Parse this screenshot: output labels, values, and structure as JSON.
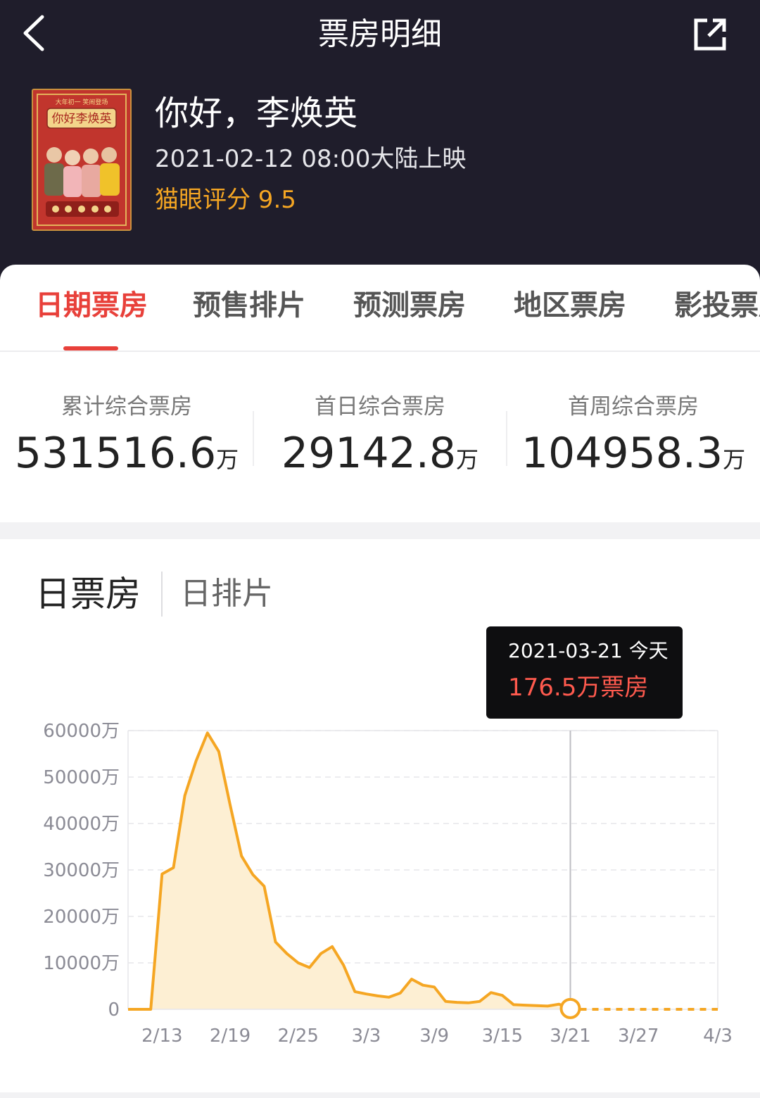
{
  "header": {
    "title": "票房明细",
    "back_icon": "back-arrow-icon",
    "share_icon": "share-icon"
  },
  "movie": {
    "title": "你好，李焕英",
    "release": "2021-02-12 08:00大陆上映",
    "rating": "猫眼评分 9.5",
    "poster_title": "你好李焕英",
    "poster_tagline": "大年初一 笑闹登场"
  },
  "tabs": [
    {
      "label": "日期票房",
      "active": true
    },
    {
      "label": "预售排片",
      "active": false
    },
    {
      "label": "预测票房",
      "active": false
    },
    {
      "label": "地区票房",
      "active": false
    },
    {
      "label": "影投票房",
      "active": false
    }
  ],
  "stats": [
    {
      "label": "累计综合票房",
      "value": "531516.6",
      "unit": "万"
    },
    {
      "label": "首日综合票房",
      "value": "29142.8",
      "unit": "万"
    },
    {
      "label": "首周综合票房",
      "value": "104958.3",
      "unit": "万"
    }
  ],
  "chart_tabs": {
    "active": "日票房",
    "other": "日排片"
  },
  "tooltip": {
    "date": "2021-03-21 今天",
    "value": "176.5万票房"
  },
  "colors": {
    "accent": "#e8403a",
    "line": "#f5a623",
    "area": "#fdefd3",
    "header_bg": "#1f1d2b"
  },
  "chart_data": {
    "type": "area",
    "ylabel_unit": "万",
    "ylim": [
      0,
      60000
    ],
    "yticks": [
      "60000万",
      "50000万",
      "40000万",
      "30000万",
      "20000万",
      "10000万",
      "0"
    ],
    "xticks": [
      "2/13",
      "2/19",
      "2/25",
      "3/3",
      "3/9",
      "3/15",
      "3/21",
      "3/27",
      "4/3"
    ],
    "series": [
      {
        "x": [
          "2/10",
          "2/11",
          "2/12",
          "2/13",
          "2/14",
          "2/15",
          "2/16",
          "2/17",
          "2/18",
          "2/19",
          "2/20",
          "2/21",
          "2/22",
          "2/23",
          "2/24",
          "2/25",
          "2/26",
          "2/27",
          "2/28",
          "3/1",
          "3/2",
          "3/3",
          "3/4",
          "3/5",
          "3/6",
          "3/7",
          "3/8",
          "3/9",
          "3/10",
          "3/11",
          "3/12",
          "3/13",
          "3/14",
          "3/15",
          "3/16",
          "3/17",
          "3/18",
          "3/19",
          "3/20",
          "3/21"
        ],
        "values": [
          0,
          0,
          0,
          29142,
          30500,
          46000,
          53500,
          59500,
          55500,
          44000,
          33000,
          29000,
          26500,
          14500,
          12000,
          10000,
          9000,
          12000,
          13500,
          9500,
          3800,
          3300,
          2900,
          2600,
          3500,
          6500,
          5200,
          4800,
          1700,
          1500,
          1400,
          1700,
          3600,
          3000,
          1000,
          900,
          800,
          700,
          1100,
          176.5
        ]
      }
    ],
    "forecast": {
      "x": [
        "3/22",
        "4/3"
      ],
      "values": [
        0,
        0
      ],
      "style": "dashed"
    },
    "selected_point": {
      "x": "3/21",
      "value": 176.5
    }
  }
}
